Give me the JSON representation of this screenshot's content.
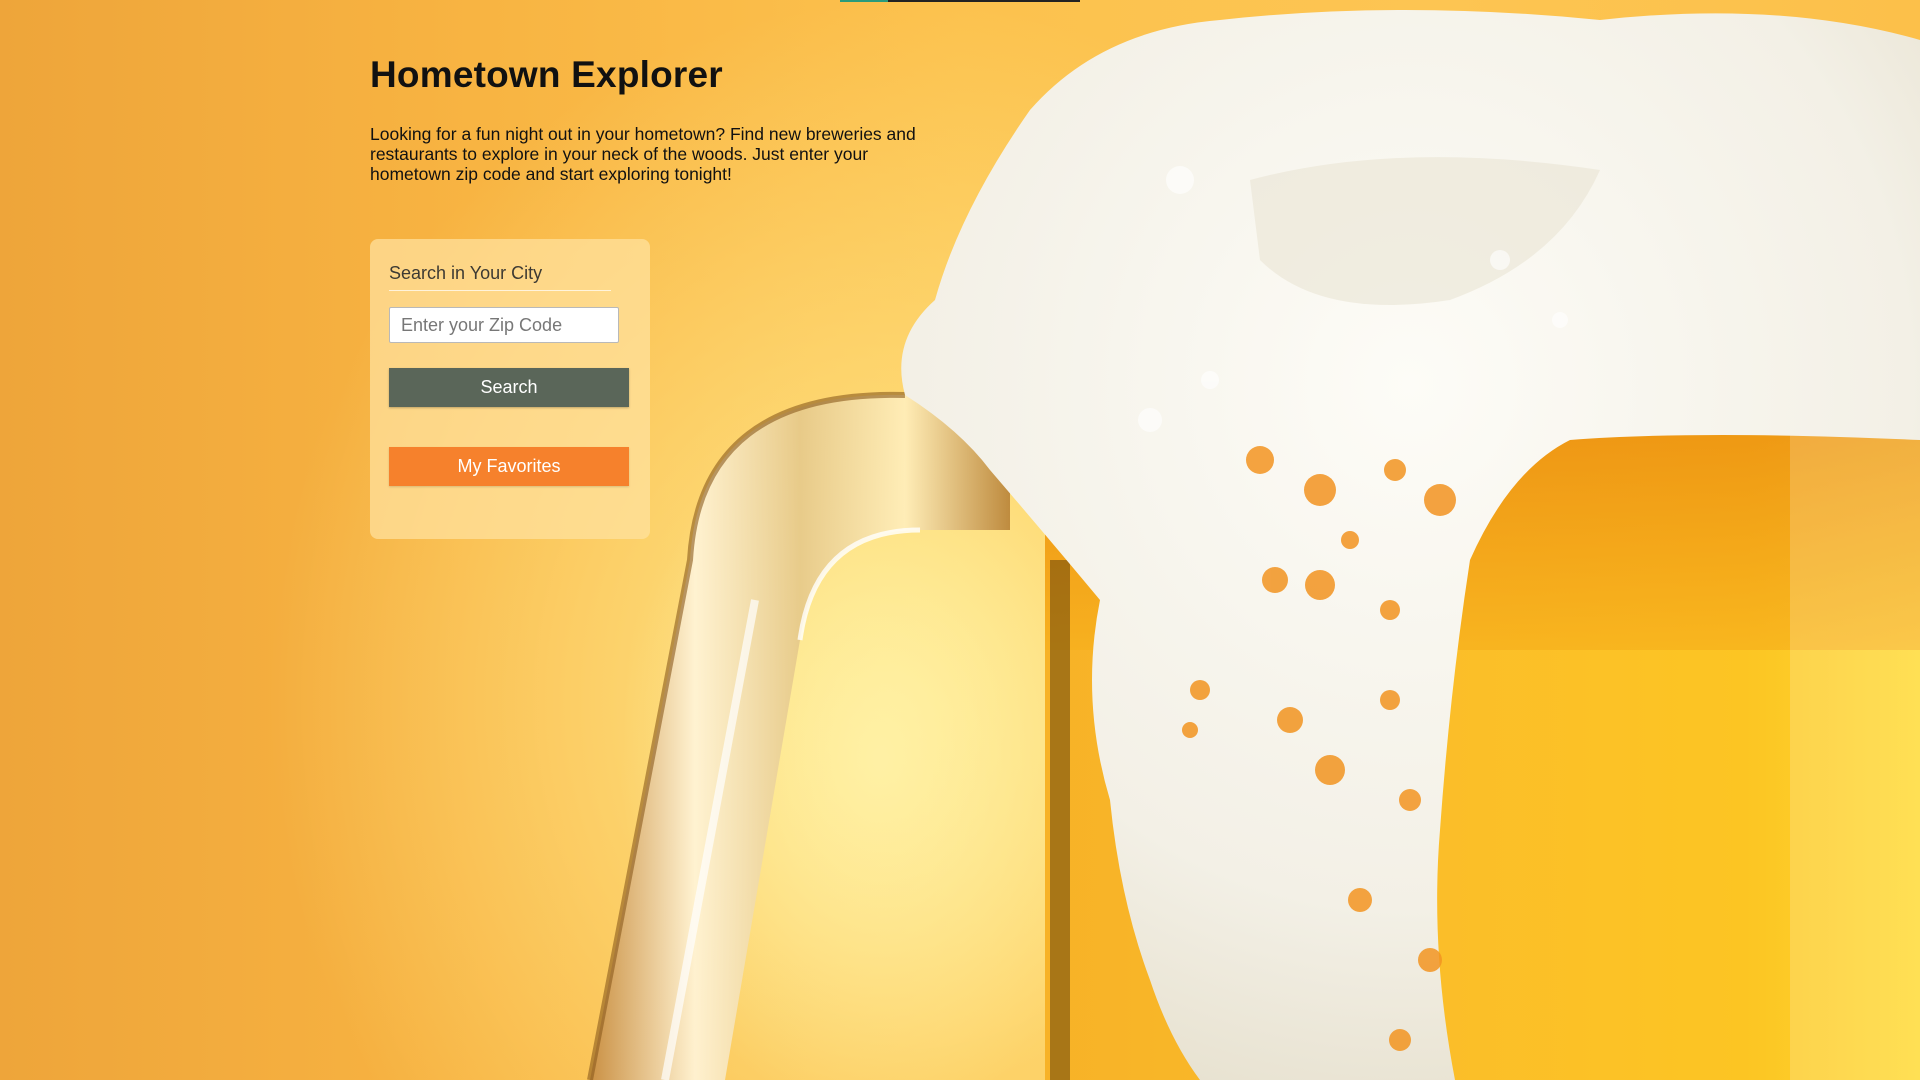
{
  "header": {
    "title": "Hometown Explorer",
    "intro": "Looking for a fun night out in your hometown? Find new breweries and restaurants to explore in your neck of the woods. Just enter your hometown zip code and start exploring tonight!"
  },
  "search": {
    "title": "Search in Your City",
    "zip_value": "",
    "zip_placeholder": "Enter your Zip Code",
    "search_label": "Search",
    "favorites_label": "My Favorites"
  },
  "background": {
    "subject": "beer mug with foam",
    "colors": {
      "background_warm": "#f8b442",
      "beer": "#f6a20e",
      "foam": "#f6f4ee",
      "glass_handle": "#d9c9a8"
    }
  },
  "colors": {
    "search_button": "#5a6659",
    "favorites_button": "#f6812c",
    "card": "#ffe2a0",
    "tab_accent": "#2a9b7b"
  }
}
